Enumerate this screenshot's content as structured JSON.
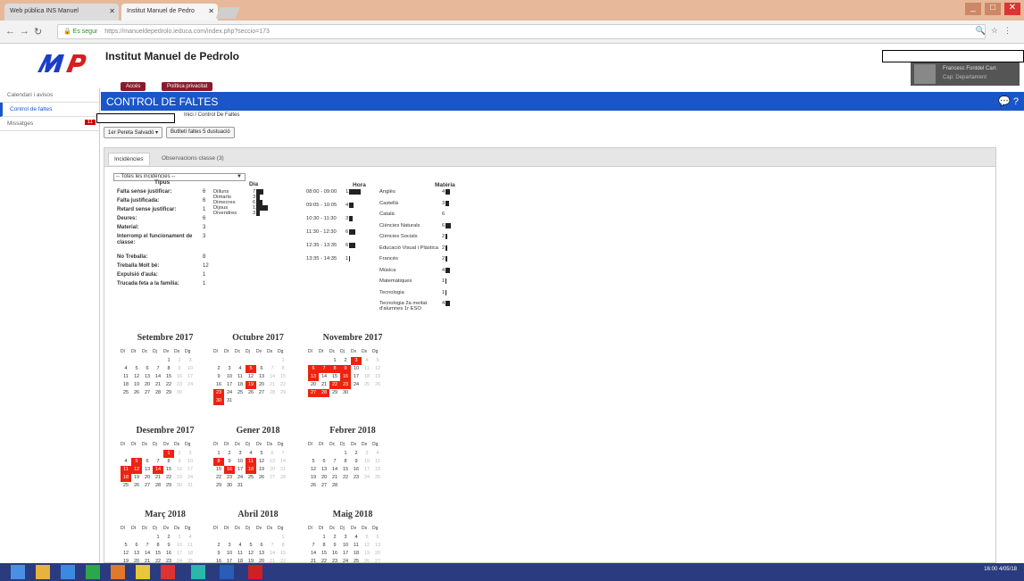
{
  "browser": {
    "tabs": [
      {
        "label": "Web pública INS Manuel"
      },
      {
        "label": "Institut Manuel de Pedro"
      }
    ],
    "url_secure": "Es segur",
    "url": "https://manueldepedrolo.ieduca.com/index.php?seccio=173",
    "window_controls": [
      "_",
      "□",
      "✕"
    ]
  },
  "header": {
    "title": "Institut Manuel de Pedrolo",
    "buttons": [
      "Accés",
      "Política privacitat"
    ],
    "user_name": "Francesc Fontdel Carr.",
    "user_role": "Cap: Departament"
  },
  "sidebar": {
    "items": [
      {
        "label": "Calendari i avisos",
        "badge": ""
      },
      {
        "label": "Control de faltes",
        "badge": ""
      },
      {
        "label": "Missatges",
        "badge": "11"
      }
    ]
  },
  "page": {
    "heading": "CONTROL DE FALTES",
    "breadcrumb": "Inici / Control De Faltes",
    "student_button": "1er Pereta Salvadó ▾",
    "report_button": "Butlletí faltes 5 dustuació"
  },
  "panel": {
    "tabs": [
      "Incidències",
      "Observacions classe (3)"
    ],
    "filter": "-- Totes les incidències --",
    "sections": {
      "tipus": "Tipus",
      "dia": "Dia",
      "hora": "Hora",
      "materia": "Matèria"
    },
    "tipus": [
      {
        "label": "Falta sense justificar:",
        "value": "6"
      },
      {
        "label": "Falta justificada:",
        "value": "6"
      },
      {
        "label": "Retard sense justificar:",
        "value": "1"
      },
      {
        "label": "Deures:",
        "value": "6"
      },
      {
        "label": "Material:",
        "value": "3"
      },
      {
        "label": "Interromp el funcionament de classe:",
        "value": "3"
      },
      {
        "label": "No Treballa:",
        "value": "8"
      },
      {
        "label": "Treballa Molt bé:",
        "value": "12"
      },
      {
        "label": "Expulsió d'aula:",
        "value": "1"
      },
      {
        "label": "Trucada feta a la familia:",
        "value": "1"
      }
    ],
    "dia": [
      {
        "label": "Dilluns",
        "value": "7",
        "level": 0.55
      },
      {
        "label": "Dimarts",
        "value": "3",
        "level": 0.3
      },
      {
        "label": "Dimecres",
        "value": "6",
        "level": 0.5
      },
      {
        "label": "Dijous",
        "value": "11",
        "level": 0.9
      },
      {
        "label": "Divendres",
        "value": "3",
        "level": 0.3
      }
    ],
    "hora": [
      {
        "label": "08:00 - 09:00",
        "value": "11",
        "level": 0.9
      },
      {
        "label": "09:05 - 10:05",
        "value": "4",
        "level": 0.35
      },
      {
        "label": "10:30 - 11:30",
        "value": "3",
        "level": 0.3
      },
      {
        "label": "11:30 - 12:30",
        "value": "6",
        "level": 0.5
      },
      {
        "label": "12:35 - 13:35",
        "value": "6",
        "level": 0.5
      },
      {
        "label": "13:35 - 14:35",
        "value": "1",
        "level": 0.1
      }
    ],
    "materia": [
      {
        "label": "Anglès",
        "value": "4",
        "level": 0.4
      },
      {
        "label": "Castellà",
        "value": "3",
        "level": 0.3
      },
      {
        "label": "Català",
        "value": "6",
        "level": 0
      },
      {
        "label": "Ciències Naturals",
        "value": "6",
        "level": 0.5
      },
      {
        "label": "Ciències Socials",
        "value": "2",
        "level": 0.2
      },
      {
        "label": "Educació Visual i Plàstica",
        "value": "2",
        "level": 0.2
      },
      {
        "label": "Francès",
        "value": "2",
        "level": 0.2
      },
      {
        "label": "Música",
        "value": "4",
        "level": 0.4
      },
      {
        "label": "Matemàtiques",
        "value": "1",
        "level": 0.1
      },
      {
        "label": "Tecnologia",
        "value": "1",
        "level": 0.1
      },
      {
        "label": "Tecnologia 2a meitat d'alumnes 1r ESO",
        "value": "4",
        "level": 0.4
      }
    ]
  },
  "calendar": {
    "dow": [
      "Dl",
      "Dt",
      "Dc",
      "Dj",
      "Dv",
      "Ds",
      "Dg"
    ],
    "months": [
      {
        "name": "Setembre 2017",
        "offset": 4,
        "days": 30,
        "absent": []
      },
      {
        "name": "Octubre 2017",
        "offset": 6,
        "days": 31,
        "absent": [
          5,
          19,
          23,
          30
        ]
      },
      {
        "name": "Novembre 2017",
        "offset": 2,
        "days": 30,
        "absent": [
          3,
          6,
          7,
          8,
          9,
          13,
          16,
          22,
          23,
          27,
          28
        ]
      },
      {
        "name": "Desembre 2017",
        "offset": 4,
        "days": 31,
        "absent": [
          1,
          5,
          11,
          12,
          14,
          18
        ]
      },
      {
        "name": "Gener 2018",
        "offset": 0,
        "days": 31,
        "absent": [
          8,
          11,
          16,
          18
        ]
      },
      {
        "name": "Febrer 2018",
        "offset": 3,
        "days": 28,
        "absent": []
      },
      {
        "name": "Març 2018",
        "offset": 3,
        "days": 31,
        "absent": []
      },
      {
        "name": "Abril 2018",
        "offset": 6,
        "days": 30,
        "absent": []
      },
      {
        "name": "Maig 2018",
        "offset": 1,
        "days": 31,
        "absent": []
      }
    ]
  },
  "taskbar": {
    "time": "16:00",
    "date": "4/05/18"
  }
}
